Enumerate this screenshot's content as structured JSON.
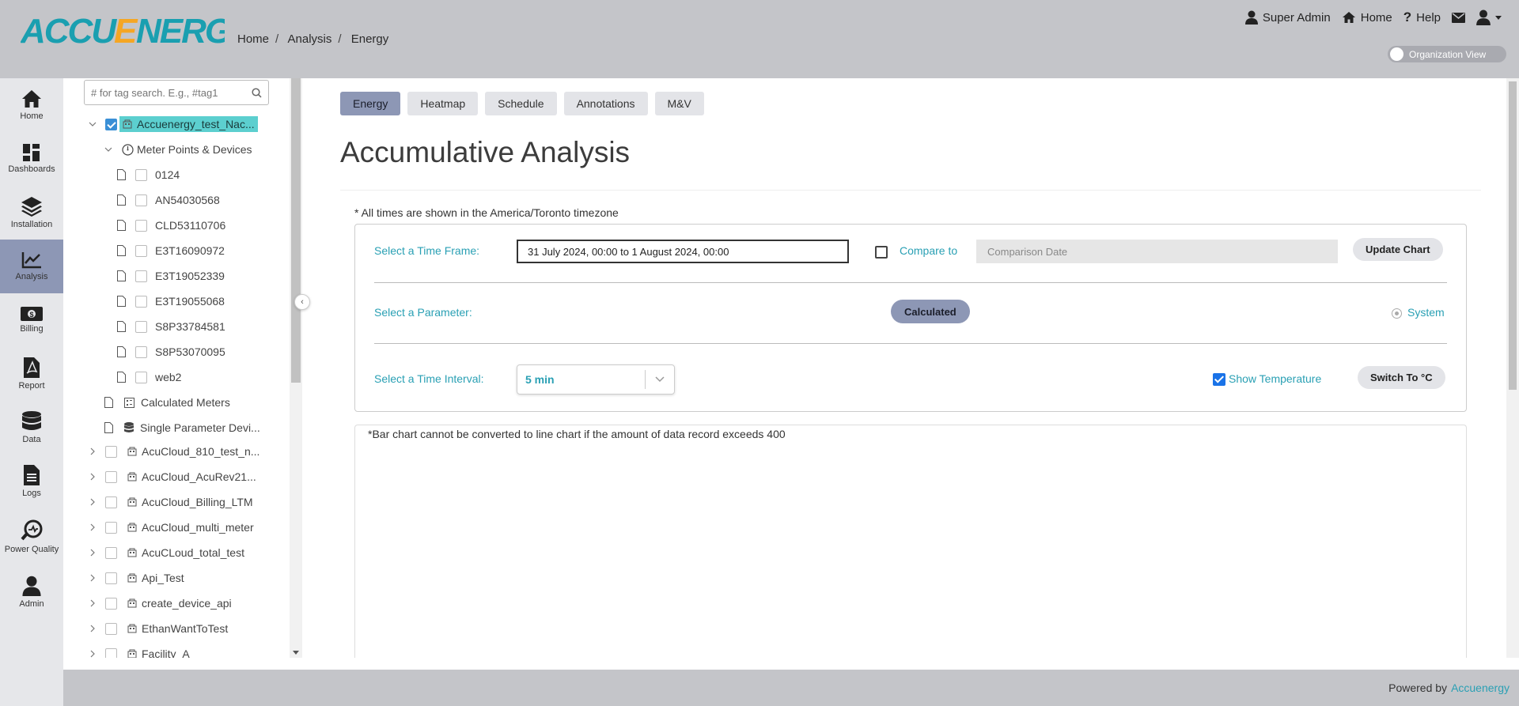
{
  "header": {
    "logo_text": "ACCUENERGY",
    "breadcrumb": [
      "Home",
      "Analysis",
      "Energy"
    ],
    "user_label": "Super Admin",
    "home_label": "Home",
    "help_label": "Help",
    "org_view_label": "Organization View"
  },
  "sidebar": {
    "items": [
      {
        "label": "Home",
        "icon": "home-icon"
      },
      {
        "label": "Dashboards",
        "icon": "dashboard-icon"
      },
      {
        "label": "Installation",
        "icon": "layers-icon"
      },
      {
        "label": "Analysis",
        "icon": "analysis-icon",
        "active": true
      },
      {
        "label": "Billing",
        "icon": "billing-icon"
      },
      {
        "label": "Report",
        "icon": "pdf-icon"
      },
      {
        "label": "Data",
        "icon": "database-icon"
      },
      {
        "label": "Logs",
        "icon": "document-icon"
      },
      {
        "label": "Power Quality",
        "icon": "power-quality-icon"
      },
      {
        "label": "Admin",
        "icon": "user-icon"
      }
    ]
  },
  "tree": {
    "search_placeholder": "# for tag search. E.g., #tag1",
    "root_label": "Accuenergy_test_Nac...",
    "meter_points_label": "Meter Points & Devices",
    "devices": [
      "0124",
      "AN54030568",
      "CLD53110706",
      "E3T16090972",
      "E3T19052339",
      "E3T19055068",
      "S8P33784581",
      "S8P53070095",
      "web2"
    ],
    "calculated_meters_label": "Calculated Meters",
    "single_param_label": "Single Parameter Devi...",
    "sites": [
      "AcuCloud_810_test_n...",
      "AcuCloud_AcuRev21...",
      "AcuCloud_Billing_LTM",
      "AcuCloud_multi_meter",
      "AcuCLoud_total_test",
      "Api_Test",
      "create_device_api",
      "EthanWantToTest",
      "Facility_A"
    ]
  },
  "main": {
    "tabs": [
      "Energy",
      "Heatmap",
      "Schedule",
      "Annotations",
      "M&V"
    ],
    "active_tab": "Energy",
    "title": "Accumulative Analysis",
    "timezone_note": "* All times are shown in the America/Toronto timezone",
    "time_frame_label": "Select a Time Frame:",
    "time_frame_value": "31 July 2024, 00:00  to  1 August 2024, 00:00",
    "compare_label": "Compare to",
    "comparison_placeholder": "Comparison Date",
    "update_button": "Update Chart",
    "parameter_label": "Select a Parameter:",
    "calculated_button": "Calculated",
    "system_label": "System",
    "interval_label": "Select a Time Interval:",
    "interval_value": "5 min",
    "show_temperature_label": "Show Temperature",
    "switch_button": "Switch To °C",
    "chart_note": "*Bar chart cannot be converted to line chart if the amount of data record exceeds 400"
  },
  "footer": {
    "powered_by": "Powered by",
    "brand": "Accuenergy"
  },
  "colors": {
    "accent": "#2aa0b4",
    "active_nav": "#8d97b5",
    "header_bg": "#c4c5c9",
    "selected_node": "#5ccfcf"
  }
}
